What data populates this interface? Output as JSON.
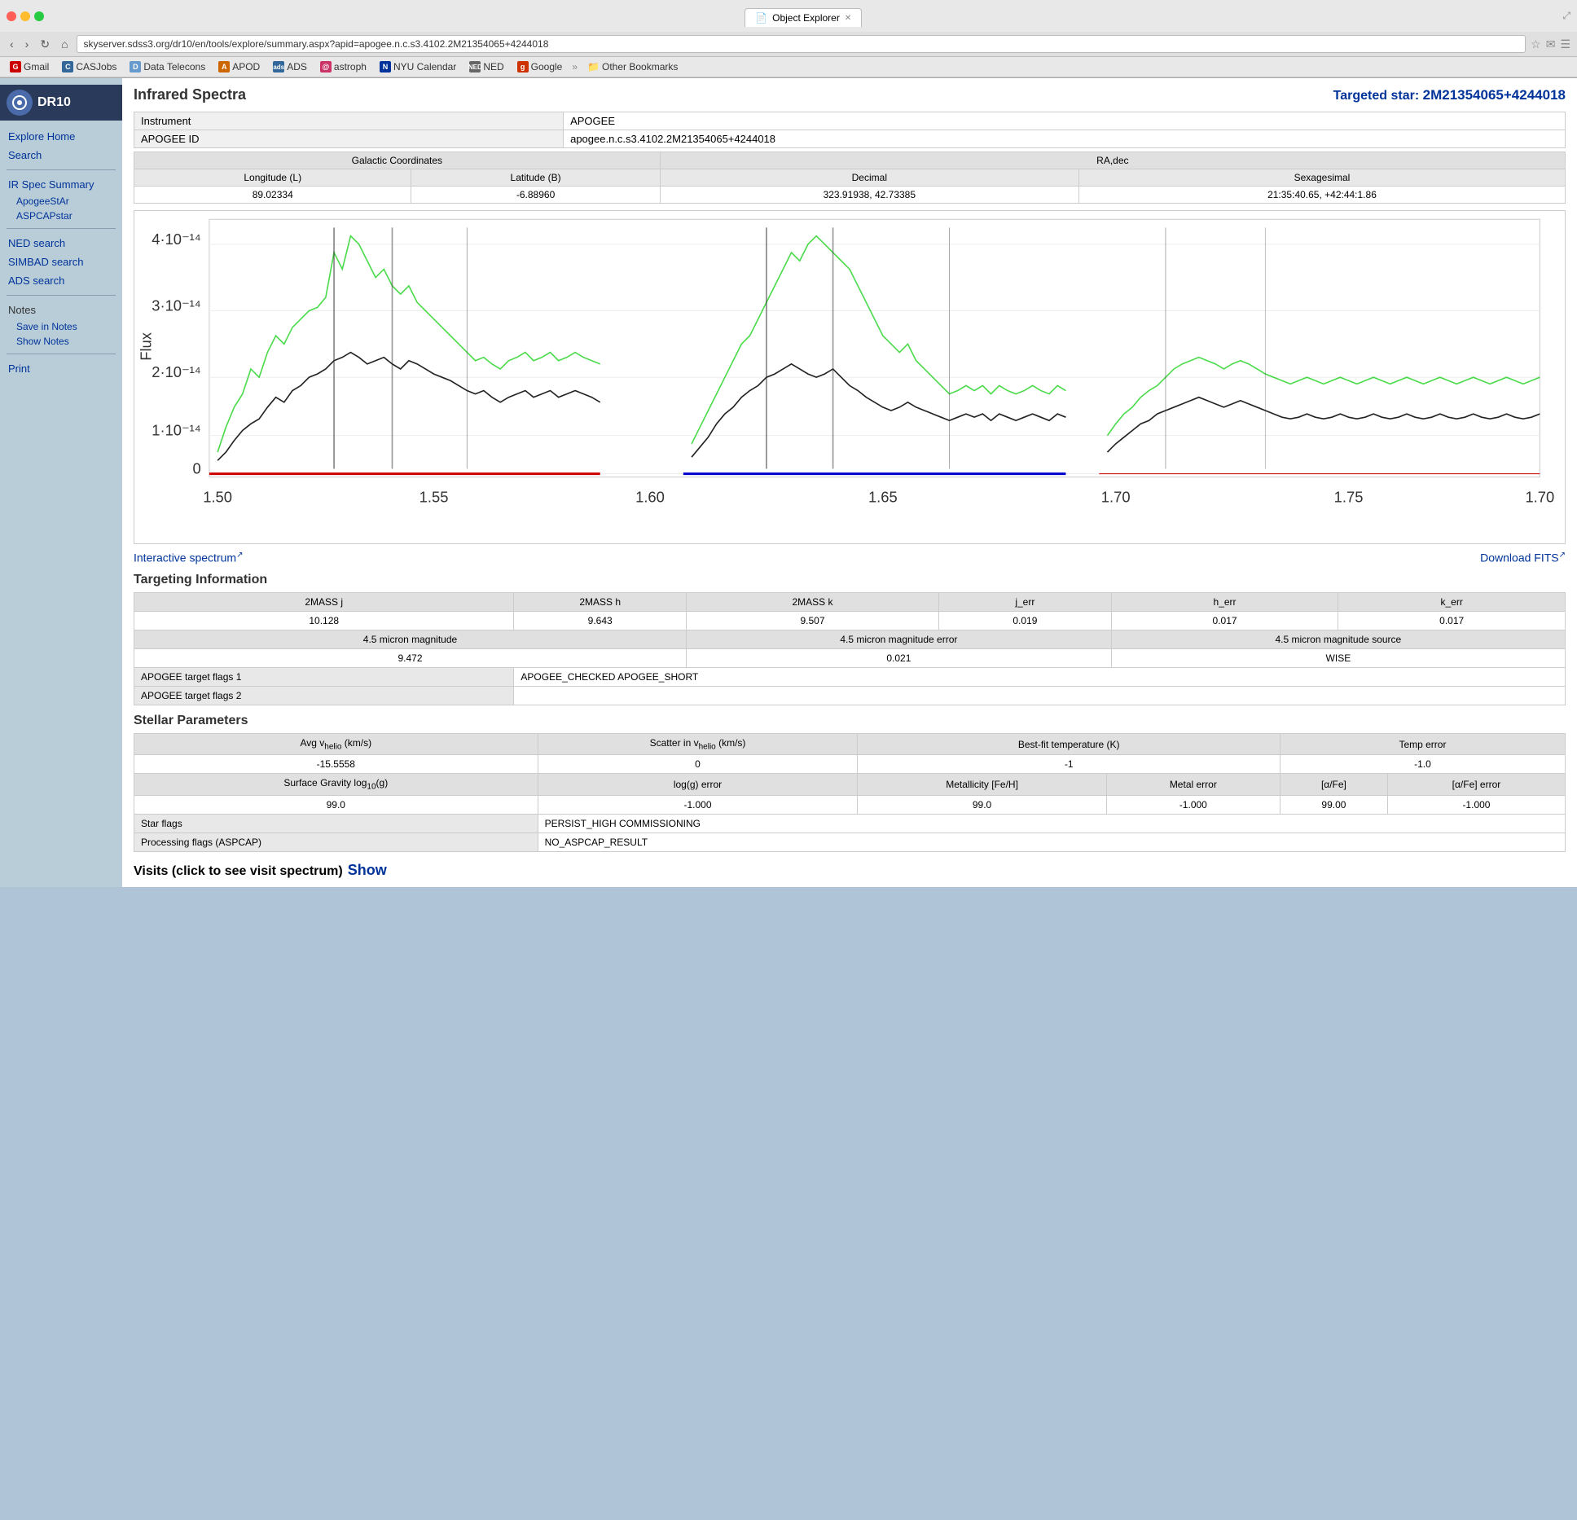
{
  "browser": {
    "tab_title": "Object Explorer",
    "address": "skyserver.sdss3.org/dr10/en/tools/explore/summary.aspx?apid=apogee.n.c.s3.4102.2M21354065+4244018",
    "bookmarks": [
      {
        "label": "Gmail",
        "color": "#cc0000"
      },
      {
        "label": "CASJobs",
        "color": "#336699"
      },
      {
        "label": "Data Telecons",
        "color": "#6699cc"
      },
      {
        "label": "APOD",
        "color": "#cc6600"
      },
      {
        "label": "ADS",
        "color": "#336699"
      },
      {
        "label": "astroph",
        "color": "#cc3366"
      },
      {
        "label": "NYU Calendar",
        "color": "#003399"
      },
      {
        "label": "NED",
        "color": "#666666"
      },
      {
        "label": "Google",
        "color": "#cc3300"
      },
      {
        "label": "Other Bookmarks",
        "color": "#666666"
      }
    ]
  },
  "sidebar": {
    "dr_label": "DR10",
    "items": [
      {
        "label": "Explore Home",
        "type": "main"
      },
      {
        "label": "Search",
        "type": "main"
      },
      {
        "label": "IR Spec Summary",
        "type": "main"
      },
      {
        "label": "ApogeeStAr",
        "type": "sub"
      },
      {
        "label": "ASPCAPstar",
        "type": "sub"
      },
      {
        "label": "NED search",
        "type": "main"
      },
      {
        "label": "SIMBAD search",
        "type": "main"
      },
      {
        "label": "ADS search",
        "type": "main"
      },
      {
        "label": "Notes",
        "type": "section"
      },
      {
        "label": "Save in Notes",
        "type": "action"
      },
      {
        "label": "Show Notes",
        "type": "action"
      },
      {
        "label": "Print",
        "type": "main"
      }
    ]
  },
  "page": {
    "title": "Infrared Spectra",
    "targeted_star_label": "Targeted star:",
    "targeted_star_id": "2M21354065+4244018",
    "instrument_label": "Instrument",
    "instrument_value": "APOGEE",
    "apogee_id_label": "APOGEE ID",
    "apogee_id_value": "apogee.n.c.s3.4102.2M21354065+4244018",
    "coords": {
      "galactic_label": "Galactic Coordinates",
      "radec_label": "RA,dec",
      "longitude_label": "Longitude (L)",
      "latitude_label": "Latitude (B)",
      "decimal_label": "Decimal",
      "sexagesimal_label": "Sexagesimal",
      "longitude_value": "89.02334",
      "latitude_value": "-6.88960",
      "decimal_value": "323.91938, 42.73385",
      "sexagesimal_value": "21:35:40.65, +42:44:1.86"
    },
    "interactive_spectrum_label": "Interactive spectrum",
    "download_fits_label": "Download FITS",
    "targeting_section": "Targeting Information",
    "targeting_table": {
      "headers": [
        "2MASS j",
        "2MASS h",
        "2MASS k",
        "j_err",
        "h_err",
        "k_err"
      ],
      "row1": [
        "10.128",
        "9.643",
        "9.507",
        "0.019",
        "0.017",
        "0.017"
      ],
      "row2_headers": [
        "4.5 micron magnitude",
        "4.5 micron magnitude error",
        "4.5 micron magnitude source"
      ],
      "row2": [
        "9.472",
        "0.021",
        "WISE"
      ],
      "flags1_label": "APOGEE target flags 1",
      "flags1_value": "APOGEE_CHECKED APOGEE_SHORT",
      "flags2_label": "APOGEE target flags 2",
      "flags2_value": ""
    },
    "stellar_section": "Stellar Parameters",
    "stellar_table": {
      "headers1": [
        "Avg vₕᵉˡᴵᵒ (km/s)",
        "Scatter in vₕᵉˡᴵᵒ (km/s)",
        "Best-fit temperature (K)",
        "Temp error"
      ],
      "row1": [
        "-15.5558",
        "0",
        "-1",
        "-1.0"
      ],
      "headers2": [
        "Surface Gravity log₁₀(g)",
        "log(g) error",
        "Metallicity [Fe/H]",
        "Metal error",
        "[α/Fe]",
        "[α/Fe] error"
      ],
      "row2": [
        "99.0",
        "-1.000",
        "99.0",
        "-1.000",
        "99.00",
        "-1.000"
      ],
      "star_flags_label": "Star flags",
      "star_flags_value": "PERSIST_HIGH COMMISSIONING",
      "proc_flags_label": "Processing flags (ASPCAP)",
      "proc_flags_value": "NO_ASPCAP_RESULT"
    },
    "visits_label": "Visits (click to see visit spectrum)",
    "visits_show": "Show"
  }
}
